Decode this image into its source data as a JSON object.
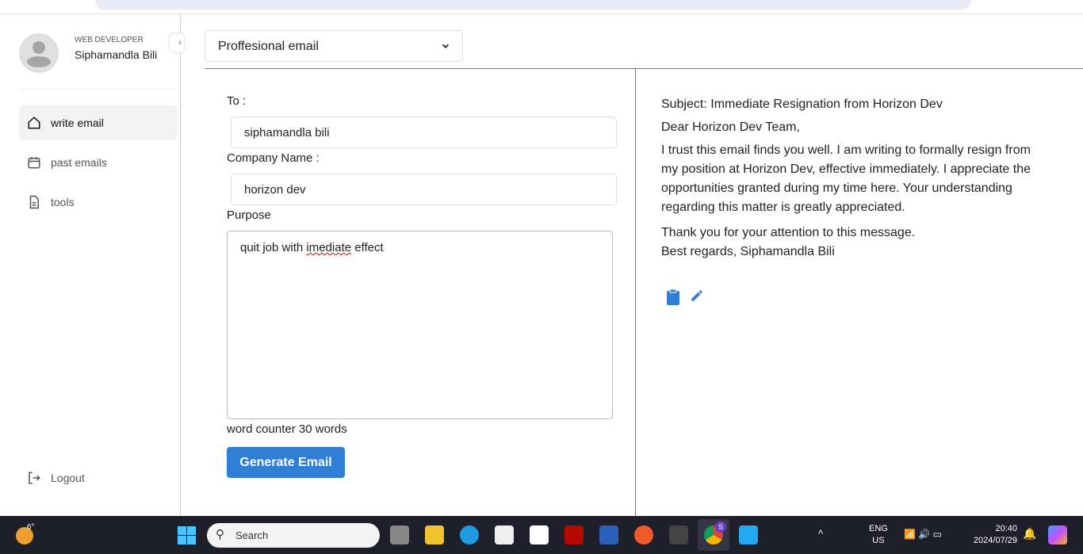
{
  "user": {
    "role": "WEB DEVELOPER",
    "name": "Siphamandla Bili"
  },
  "sidebar": {
    "items": [
      {
        "label": "write email",
        "icon": "home-icon",
        "active": true
      },
      {
        "label": "past emails",
        "icon": "calendar-icon"
      },
      {
        "label": "tools",
        "icon": "document-icon"
      }
    ],
    "logout": "Logout"
  },
  "main": {
    "email_type": "Proffesional email",
    "to_label": "To :",
    "to_value": "siphamandla bili",
    "company_label": "Company Name :",
    "company_value": "horizon dev",
    "purpose_label": "Purpose",
    "purpose_pre": "quit job with ",
    "purpose_misspelled": "imediate",
    "purpose_post": " effect",
    "word_counter": "word counter 30 words",
    "generate_label": "Generate Email"
  },
  "output": {
    "subject": "Subject: Immediate Resignation from Horizon Dev",
    "greeting": "Dear Horizon Dev Team,",
    "body": "I trust this email finds you well. I am writing to formally resign from my position at Horizon Dev, effective immediately. I appreciate the opportunities granted during my time here. Your understanding regarding this matter is greatly appreciated.",
    "thanks": "Thank you for your attention to this message.",
    "signoff": "Best regards, Siphamandla Bili",
    "accent": "#2f7fd6"
  },
  "taskbar": {
    "weather": "6°",
    "search": "Search",
    "lang": "ENG",
    "region": "US",
    "time": "20:40",
    "date": "2024/07/29",
    "chrome_badge": "S"
  }
}
